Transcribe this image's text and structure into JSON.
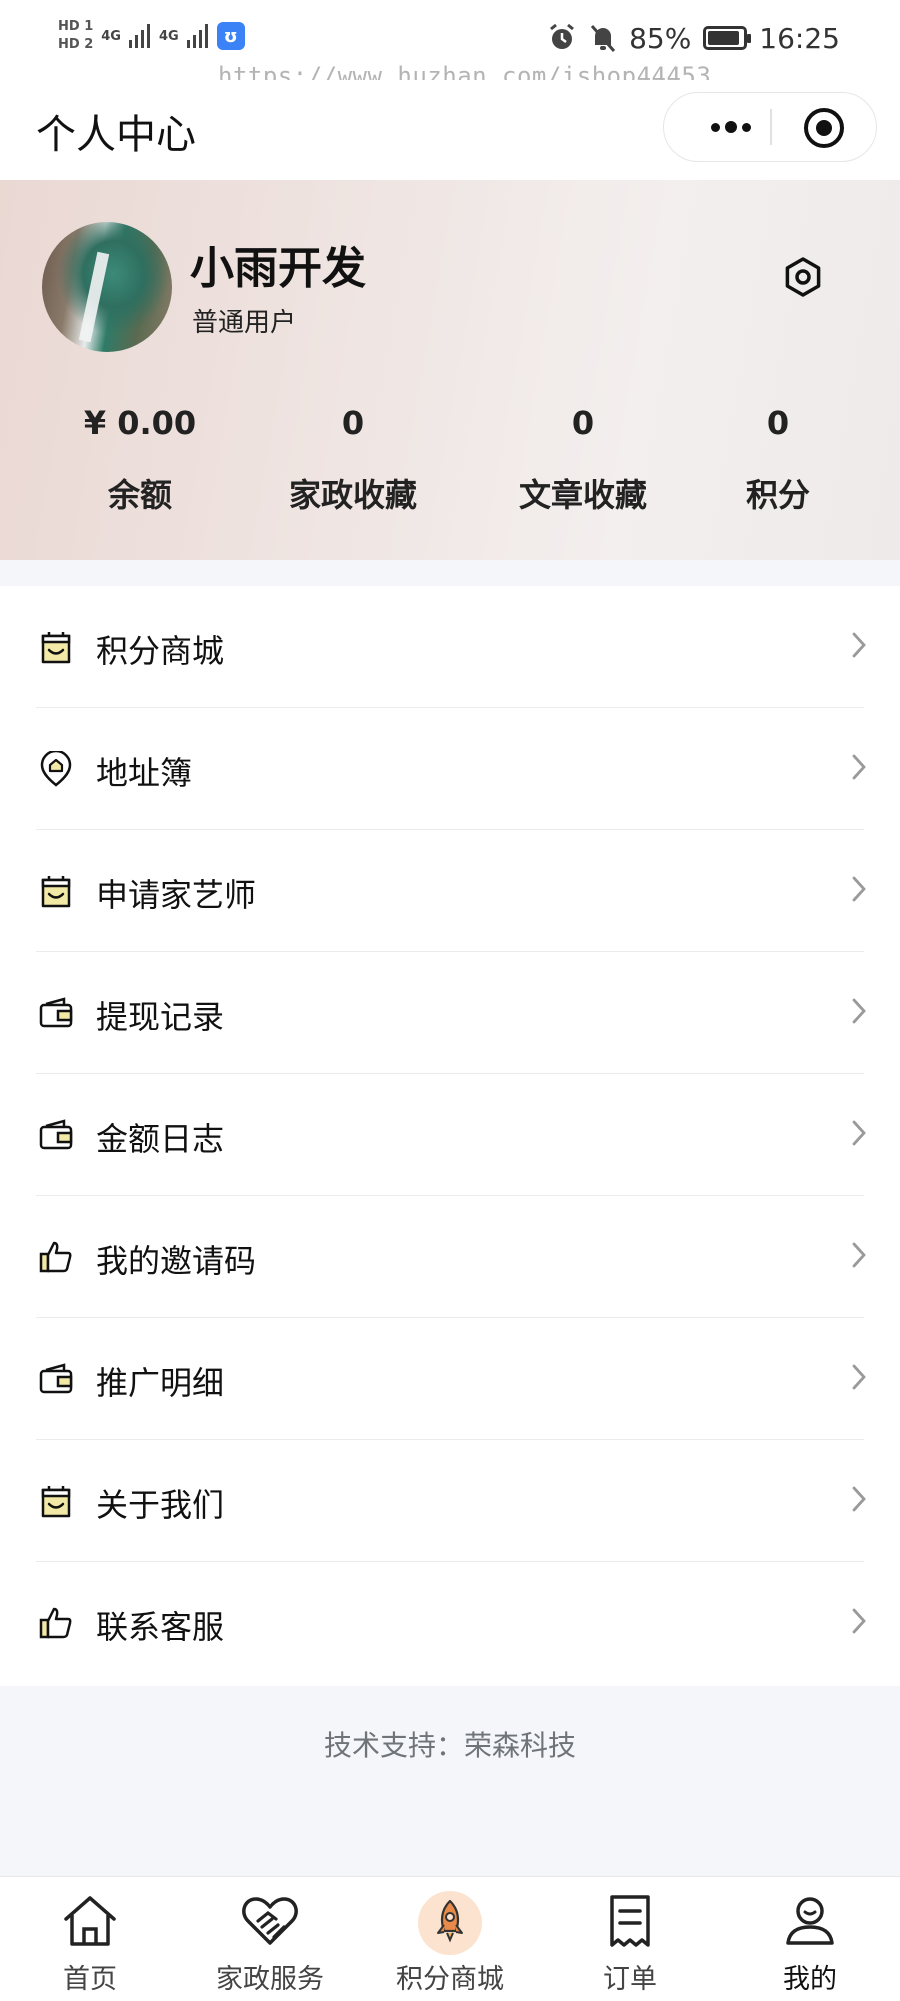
{
  "status_bar": {
    "hd1": "HD 1",
    "hd2": "HD 2",
    "net1": "4G",
    "net2": "4G",
    "battery": "85%",
    "time": "16:25"
  },
  "watermark": "https://www.huzhan.com/ishop44453",
  "nav": {
    "title": "个人中心"
  },
  "profile": {
    "username": "小雨开发",
    "user_type": "普通用户",
    "stats": [
      {
        "value": "¥ 0.00",
        "label": "余额"
      },
      {
        "value": "0",
        "label": "家政收藏"
      },
      {
        "value": "0",
        "label": "文章收藏"
      },
      {
        "value": "0",
        "label": "积分"
      }
    ]
  },
  "menu": [
    {
      "label": "积分商城",
      "icon": "bag-icon"
    },
    {
      "label": "地址簿",
      "icon": "location-icon"
    },
    {
      "label": "申请家艺师",
      "icon": "bag-icon"
    },
    {
      "label": "提现记录",
      "icon": "wallet-icon"
    },
    {
      "label": "金额日志",
      "icon": "wallet-icon"
    },
    {
      "label": "我的邀请码",
      "icon": "thumbs-up-icon"
    },
    {
      "label": "推广明细",
      "icon": "wallet-icon"
    },
    {
      "label": "关于我们",
      "icon": "bag-icon"
    },
    {
      "label": "联系客服",
      "icon": "thumbs-up-icon"
    }
  ],
  "footer": {
    "support": "技术支持：荣森科技"
  },
  "tabbar": [
    {
      "label": "首页",
      "icon": "home-icon"
    },
    {
      "label": "家政服务",
      "icon": "heart-handshake-icon"
    },
    {
      "label": "积分商城",
      "icon": "rocket-icon"
    },
    {
      "label": "订单",
      "icon": "receipt-icon"
    },
    {
      "label": "我的",
      "icon": "user-icon",
      "active": true
    }
  ],
  "colors": {
    "icon_accent": "#f3e9a6",
    "rocket_accent": "#e88a4a",
    "footer_bg": "#f4f6f9"
  }
}
